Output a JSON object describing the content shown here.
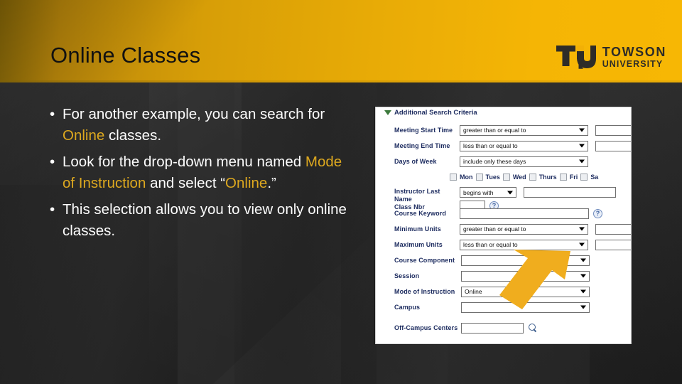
{
  "slide": {
    "title": "Online Classes",
    "theme": {
      "accent_gold": "#f0ad08",
      "highlight_text": "#dda81f",
      "body_text": "#ffffff",
      "background": "#292929"
    }
  },
  "logo": {
    "monogram": "TU",
    "line1": "TOWSON",
    "line2": "UNIVERSITY"
  },
  "bullets": [
    {
      "marker": "•",
      "parts": [
        {
          "text": "For another example, you can search for ",
          "style": "normal"
        },
        {
          "text": "Online",
          "style": "highlight"
        },
        {
          "text": " classes.",
          "style": "normal"
        }
      ]
    },
    {
      "marker": "•",
      "parts": [
        {
          "text": "Look for the drop-down menu named ",
          "style": "normal"
        },
        {
          "text": "Mode of Instruction",
          "style": "highlight"
        },
        {
          "text": " and select “",
          "style": "normal"
        },
        {
          "text": "Online",
          "style": "highlight"
        },
        {
          "text": ".”",
          "style": "normal"
        }
      ]
    },
    {
      "marker": "•",
      "parts": [
        {
          "text": "This selection allows you to view only online classes.",
          "style": "normal"
        }
      ]
    }
  ],
  "screenshot": {
    "section_header": "Additional Search Criteria",
    "rows": {
      "meeting_start_time": {
        "label": "Meeting Start Time",
        "operator": "greater than or equal to"
      },
      "meeting_end_time": {
        "label": "Meeting End Time",
        "operator": "less than or equal to"
      },
      "days_of_week": {
        "label": "Days of Week",
        "operator": "include only these days"
      },
      "instructor_last_name": {
        "label1": "Instructor Last",
        "label2": "Name",
        "operator": "begins with",
        "value": ""
      },
      "class_nbr": {
        "label": "Class Nbr",
        "value": ""
      },
      "course_keyword": {
        "label": "Course Keyword",
        "value": ""
      },
      "minimum_units": {
        "label": "Minimum Units",
        "operator": "greater than or equal to"
      },
      "maximum_units": {
        "label": "Maximum Units",
        "operator": "less than or equal to"
      },
      "course_component": {
        "label": "Course Component",
        "operator": ""
      },
      "session": {
        "label": "Session",
        "operator": ""
      },
      "mode_of_instruction": {
        "label": "Mode of Instruction",
        "operator": "Online"
      },
      "campus": {
        "label": "Campus",
        "operator": ""
      },
      "off_campus_centers": {
        "label": "Off-Campus Centers",
        "value": ""
      }
    },
    "day_checkboxes": [
      "Mon",
      "Tues",
      "Wed",
      "Thurs",
      "Fri",
      "Sa"
    ],
    "help_marker": "?"
  },
  "annotation": {
    "arrow_color": "#f0ad1e",
    "points_to": "mode_of_instruction"
  }
}
